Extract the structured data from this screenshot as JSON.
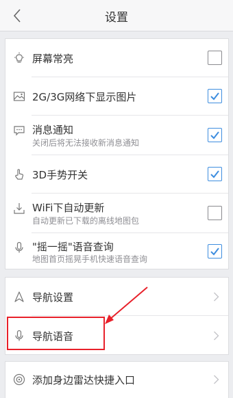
{
  "header": {
    "title": "设置"
  },
  "group1": [
    {
      "label": "屏幕常亮",
      "sub": "",
      "checked": false,
      "icon": "bulb-icon"
    },
    {
      "label": "2G/3G网络下显示图片",
      "sub": "",
      "checked": true,
      "icon": "image-icon"
    },
    {
      "label": "消息通知",
      "sub": "关闭后将无法接收新消息通知",
      "checked": true,
      "icon": "message-icon"
    },
    {
      "label": "3D手势开关",
      "sub": "",
      "checked": true,
      "icon": "hand-icon"
    },
    {
      "label": "WiFi下自动更新",
      "sub": "自动更新已下载的离线地图包",
      "checked": false,
      "icon": "download-icon"
    },
    {
      "label": "\"摇一摇\"语音查询",
      "sub": "地图首页摇晃手机快速语音查询",
      "checked": true,
      "icon": "mic-icon"
    }
  ],
  "group2": [
    {
      "label": "导航设置",
      "icon": "navigation-arrow-icon"
    },
    {
      "label": "导航语音",
      "icon": "mic-icon"
    }
  ],
  "group3": [
    {
      "label": "添加身边雷达快捷入口",
      "icon": "radar-icon"
    }
  ],
  "colors": {
    "accent": "#3d8ddf",
    "highlight": "#e8202a"
  }
}
